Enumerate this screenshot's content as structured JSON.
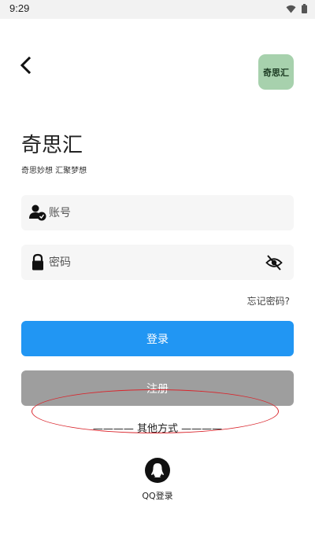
{
  "status_bar": {
    "time": "9:29"
  },
  "header": {
    "logo_text": "奇思汇"
  },
  "brand": {
    "title": "奇思汇",
    "subtitle": "奇思妙想  汇聚梦想"
  },
  "form": {
    "account_placeholder": "账号",
    "password_placeholder": "密码",
    "forgot_label": "忘记密码?"
  },
  "buttons": {
    "login_label": "登录",
    "register_label": "注册"
  },
  "divider": {
    "label": "———— 其他方式 ————"
  },
  "qq": {
    "label": "QQ登录"
  },
  "colors": {
    "primary": "#2196f3",
    "secondary": "#9e9e9e",
    "logo_bg": "#a7d1ad",
    "annotation": "#d9252c"
  },
  "icons": {
    "back": "chevron-left-icon",
    "account": "user-check-icon",
    "lock": "lock-icon",
    "visibility": "eye-off-icon",
    "qq": "qq-penguin-icon"
  }
}
